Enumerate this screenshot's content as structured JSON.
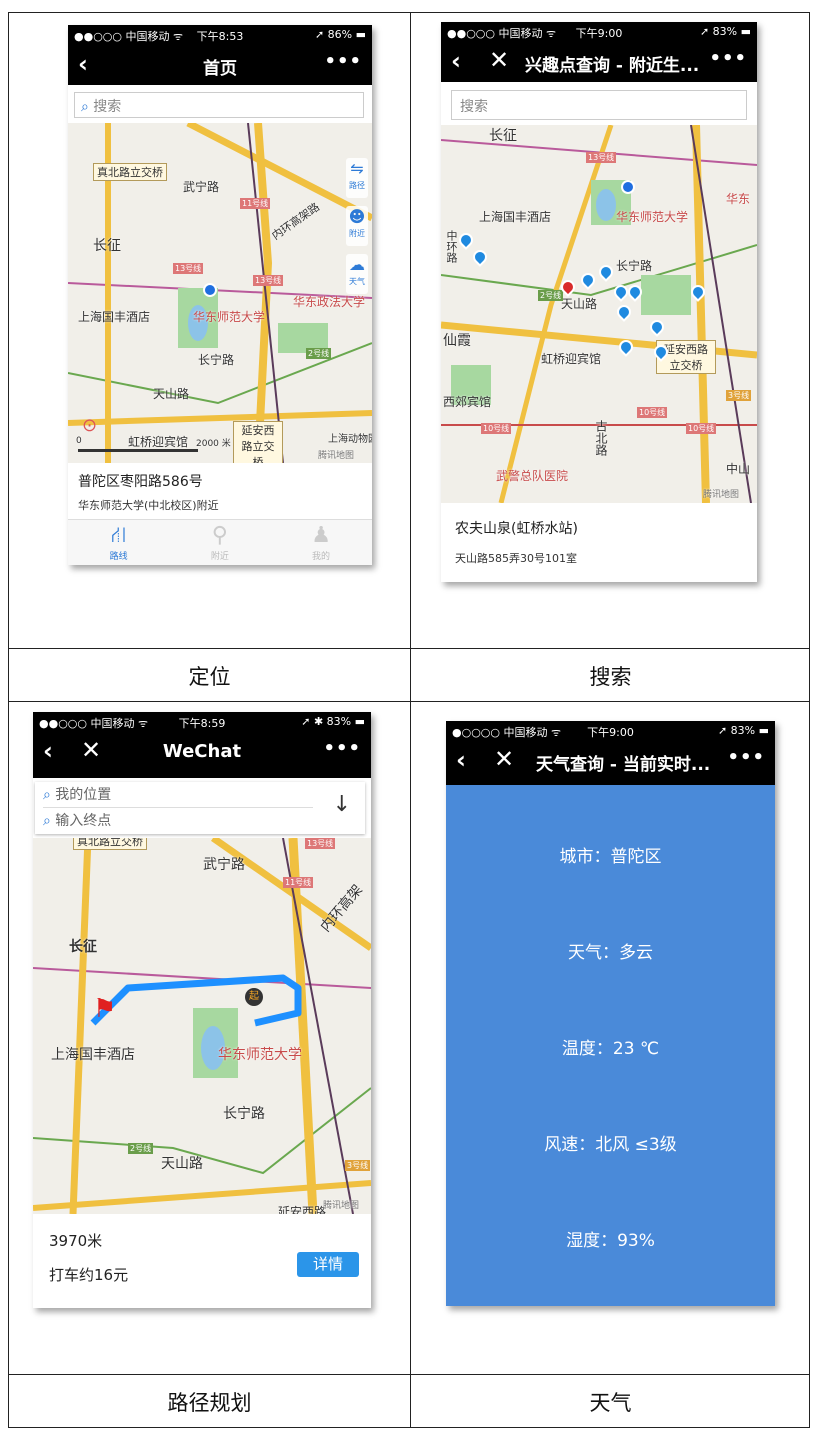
{
  "captions": [
    "定位",
    "搜索",
    "路径规划",
    "天气"
  ],
  "phone1": {
    "status": {
      "carrier": "●●○○○ 中国移动 ᯤ",
      "time": "下午8:53",
      "battery": "➚ 86% ▬"
    },
    "title": "首页",
    "more": "•••",
    "search_placeholder": "搜索",
    "map_labels": [
      "真北路立交桥",
      "武宁路",
      "长征",
      "上海国丰酒店",
      "华东师范大学",
      "华东政法大学",
      "长宁路",
      "天山路",
      "虹桥迎宾馆",
      "延安西路立交桥",
      "上海动物园",
      "内环高架路"
    ],
    "line_tags": [
      "11号线",
      "13号线",
      "2号线",
      "13号线"
    ],
    "side_icons": [
      "路径",
      "附近",
      "天气"
    ],
    "scale": {
      "left": "0",
      "right": "2000 米"
    },
    "map_credit": "腾讯地图",
    "address": "普陀区枣阳路586号",
    "address_sub": "华东师范大学(中北校区)附近",
    "tabs": [
      "路线",
      "附近",
      "我的"
    ]
  },
  "phone2": {
    "status": {
      "carrier": "●●○○○ 中国移动 ᯤ",
      "time": "下午9:00",
      "battery": "➚ 83% ▬"
    },
    "title": "兴趣点查询 - 附近生...",
    "more": "•••",
    "search_placeholder": "搜索",
    "map_labels": [
      "长征",
      "上海国丰酒店",
      "华东师范大学",
      "华东",
      "长宁路",
      "天山路",
      "仙霞",
      "虹桥迎宾馆",
      "延安西路立交桥",
      "西郊宾馆",
      "古北路",
      "武警总队医院",
      "中山",
      "中环路"
    ],
    "line_tags": [
      "13号线",
      "2号线",
      "10号线",
      "10号线",
      "10号线",
      "3号线"
    ],
    "map_credit": "腾讯地图",
    "poi_name": "农夫山泉(虹桥水站)",
    "poi_address": "天山路585弄30号101室"
  },
  "phone3": {
    "status": {
      "carrier": "●●○○○ 中国移动 ᯤ",
      "time": "下午8:59",
      "battery": "➚ ✱ 83% ▬"
    },
    "title": "WeChat",
    "more": "•••",
    "start_placeholder": "我的位置",
    "end_placeholder": "输入终点",
    "map_labels": [
      "真北路立交桥",
      "武宁路",
      "长征",
      "上海国丰酒店",
      "华东师范大学",
      "长宁路",
      "天山路",
      "内环高架",
      "延安西路"
    ],
    "line_tags": [
      "11号线",
      "13号线",
      "2号线",
      "3号线"
    ],
    "start_marker": "起",
    "map_credit": "腾讯地图",
    "distance": "3970米",
    "fare": "打车约16元",
    "detail_button": "详情"
  },
  "phone4": {
    "status": {
      "carrier": "●○○○○ 中国移动 ᯤ",
      "time": "下午9:00",
      "battery": "➚ 83% ▬"
    },
    "title": "天气查询 - 当前实时...",
    "more": "•••",
    "lines": [
      "城市：普陀区",
      "天气：多云",
      "温度：23 ℃",
      "风速：北风 ≤3级",
      "湿度：93%"
    ]
  }
}
